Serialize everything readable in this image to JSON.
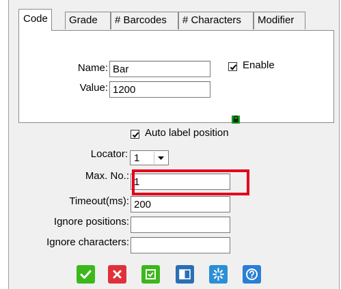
{
  "tabs": [
    {
      "label": "Code",
      "active": true
    },
    {
      "label": "Grade"
    },
    {
      "label": "# Barcodes"
    },
    {
      "label": "# Characters"
    },
    {
      "label": "Modifier"
    }
  ],
  "code_panel": {
    "name_label": "Name:",
    "name_value": "Bar",
    "value_label": "Value:",
    "value_value": "1200",
    "enable_label": "Enable",
    "enable_checked": true,
    "badge_icon": "lock-icon",
    "badge_color": "#1a9a1a"
  },
  "settings": {
    "auto_label_position": "Auto label position",
    "auto_label_checked": true,
    "locator_label": "Locator:",
    "locator_value": "1",
    "max_no_label": "Max. No.:",
    "max_no_value": "1",
    "timeout_label": "Timeout(ms):",
    "timeout_value": "200",
    "ignore_positions_label": "Ignore positions:",
    "ignore_positions_value": "",
    "ignore_characters_label": "Ignore characters:",
    "ignore_characters_value": ""
  },
  "toolbar": [
    {
      "icon": "check-icon",
      "color": "#3cb81c"
    },
    {
      "icon": "close-icon",
      "color": "#e0313b"
    },
    {
      "icon": "checkbox-icon",
      "color": "#3cb81c"
    },
    {
      "icon": "panel-icon",
      "color": "#2a6fb5"
    },
    {
      "icon": "sparkle-icon",
      "color": "#2a8fd6"
    },
    {
      "icon": "help-icon",
      "color": "#2a7fd6"
    }
  ],
  "highlight_color": "#e3001b"
}
